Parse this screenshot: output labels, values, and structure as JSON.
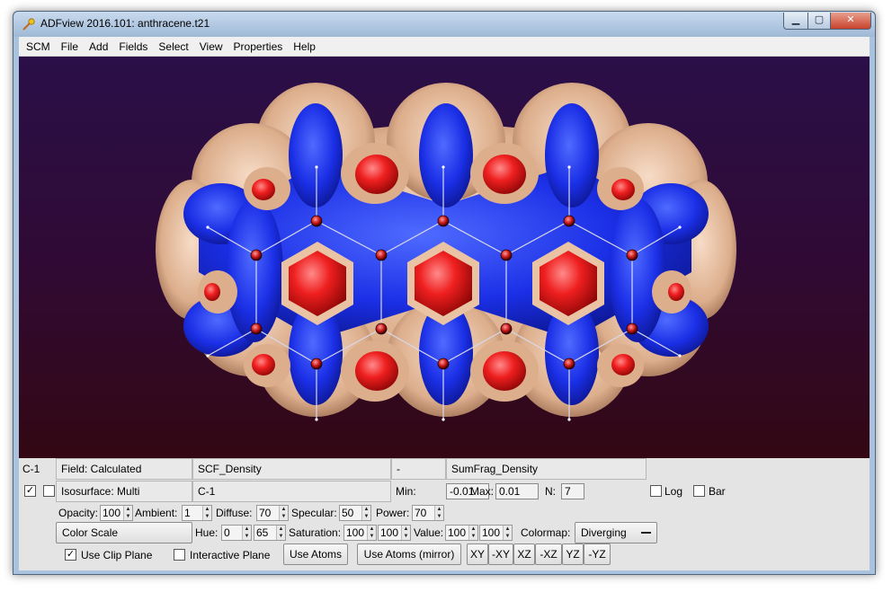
{
  "window": {
    "title": "ADFview 2016.101: anthracene.t21",
    "minimize": "▁",
    "maximize": "▢",
    "close": "✕"
  },
  "menu": [
    "SCM",
    "File",
    "Add",
    "Fields",
    "Select",
    "View",
    "Properties",
    "Help"
  ],
  "row1": {
    "atom": "C-1",
    "field_label": "Field: Calculated",
    "field_name": "SCF_Density",
    "operator": "-",
    "field2_name": "SumFrag_Density"
  },
  "row2": {
    "visible_checked": "✓",
    "iso_label": "Isosurface: Multi",
    "atom": "C-1",
    "min_label": "Min:",
    "min_value": "-0.01",
    "max_label": "Max:",
    "max_value": "0.01",
    "n_label": "N:",
    "n_value": "7",
    "log_label": "Log",
    "bar_label": "Bar"
  },
  "row3": {
    "opacity_label": "Opacity:",
    "opacity": "100",
    "ambient_label": "Ambient:",
    "ambient": "1",
    "diffuse_label": "Diffuse:",
    "diffuse": "70",
    "specular_label": "Specular:",
    "specular": "50",
    "power_label": "Power:",
    "power": "70"
  },
  "row4": {
    "color_scale": "Color Scale",
    "hue_label": "Hue:",
    "hue_min": "0",
    "hue_max": "65",
    "saturation_label": "Saturation:",
    "sat_min": "100",
    "sat_max": "100",
    "value_label": "Value:",
    "val_min": "100",
    "val_max": "100",
    "colormap_label": "Colormap:",
    "colormap": "Diverging"
  },
  "row5": {
    "clip_checked": "✓",
    "use_clip_plane": "Use Clip Plane",
    "interactive_plane": "Interactive Plane",
    "use_atoms": "Use Atoms",
    "use_atoms_mirror": "Use Atoms (mirror)",
    "views": [
      "XY",
      "-XY",
      "XZ",
      "-XZ",
      "YZ",
      "-YZ"
    ]
  },
  "colors": {
    "positive_lobe": "#e0171b",
    "negative_lobe": "#1a2ee0",
    "outer_surface": "#e8bfa2",
    "background_top": "#2a0f48",
    "background_bottom": "#330813"
  }
}
